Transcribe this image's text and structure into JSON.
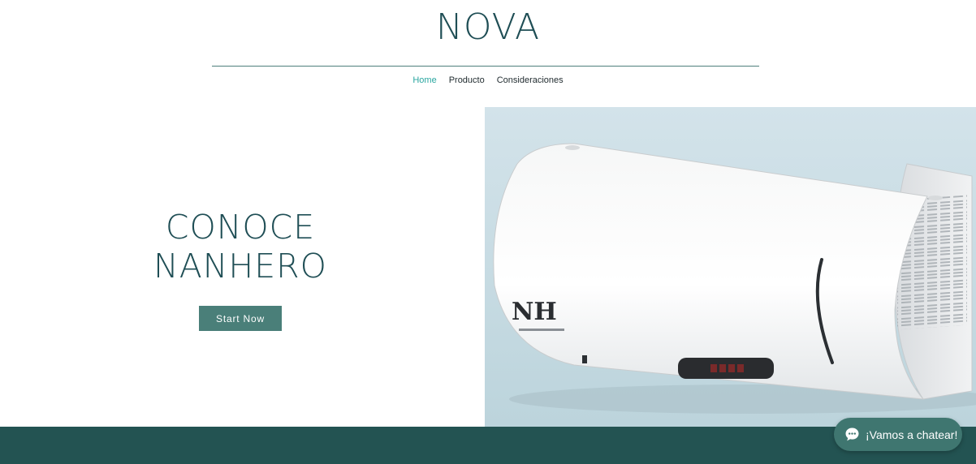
{
  "header": {
    "site_title": "NOVA",
    "nav": [
      {
        "label": "Home",
        "active": true
      },
      {
        "label": "Producto",
        "active": false
      },
      {
        "label": "Consideraciones",
        "active": false
      }
    ]
  },
  "hero": {
    "heading_line1": "CONOCE",
    "heading_line2": "NANHERO",
    "cta_label": "Start Now"
  },
  "product": {
    "logo_text": "NH",
    "display_reading": "888"
  },
  "chat": {
    "label": "¡Vamos a chatear!",
    "icon": "chat-bubble-icon"
  },
  "colors": {
    "brand_dark": "#1f4e55",
    "nav_active": "#2aa6a0",
    "button_bg": "#4a7f79",
    "footer_bg": "#235352",
    "chat_bg": "#3f7670"
  }
}
